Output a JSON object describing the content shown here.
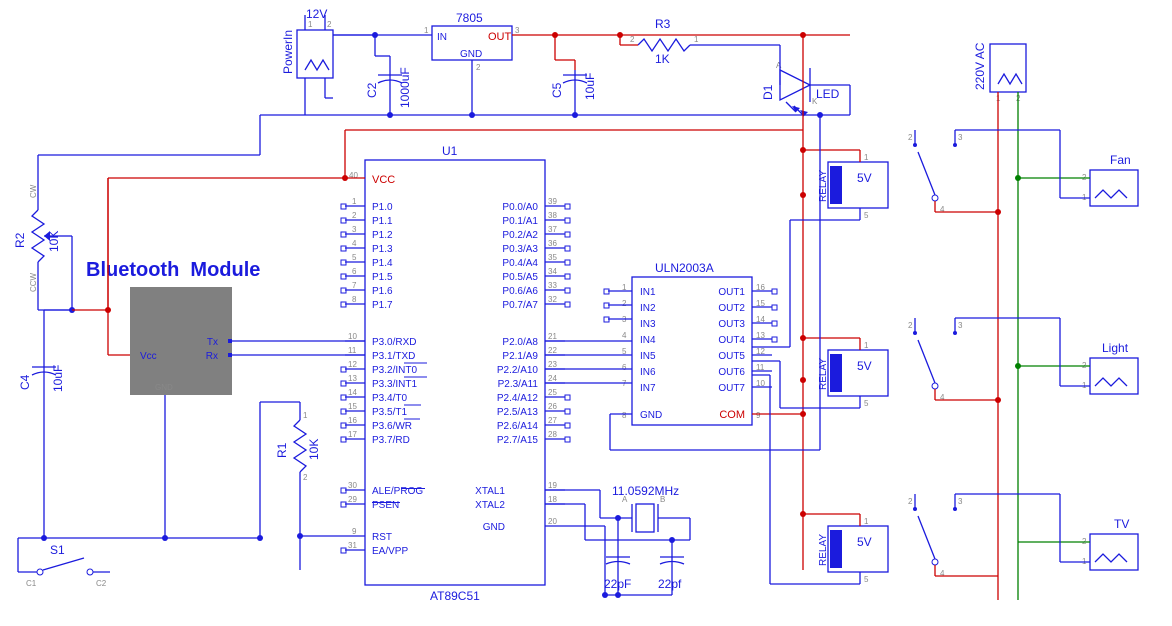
{
  "powerin": {
    "label": "PowerIn",
    "voltage": "12V"
  },
  "reg7805": {
    "label": "7805",
    "pins": {
      "in": "IN",
      "out": "OUT",
      "gnd": "GND"
    }
  },
  "c2": {
    "name": "C2",
    "val": "1000uF"
  },
  "c5": {
    "name": "C5",
    "val": "10uF"
  },
  "c4": {
    "name": "C4",
    "val": "10uF"
  },
  "r1": {
    "name": "R1",
    "val": "10K"
  },
  "r2": {
    "name": "R2",
    "val": "10K",
    "cw": "CW",
    "ccw": "CCW"
  },
  "r3": {
    "name": "R3",
    "val": "1K"
  },
  "d1": {
    "name": "D1",
    "val": "LED"
  },
  "s1": {
    "name": "S1",
    "c1": "C1",
    "c2": "C2"
  },
  "crystal": {
    "freq": "11.0592MHz",
    "a": "A",
    "b": "B"
  },
  "ccry1": "22pF",
  "ccry2": "22pf",
  "bt": {
    "title": "Bluetooth  Module",
    "vcc": "Vcc",
    "tx": "Tx",
    "rx": "Rx",
    "gnd": "GND"
  },
  "u1": {
    "ref": "U1",
    "part": "AT89C51",
    "vcc": "VCC",
    "p1": [
      "P1.0",
      "P1.1",
      "P1.2",
      "P1.3",
      "P1.4",
      "P1.5",
      "P1.6",
      "P1.7"
    ],
    "p1n": [
      "1",
      "2",
      "3",
      "4",
      "5",
      "6",
      "7",
      "8"
    ],
    "p0": [
      "P0.0/A0",
      "P0.1/A1",
      "P0.2/A2",
      "P0.3/A3",
      "P0.4/A4",
      "P0.5/A5",
      "P0.6/A6",
      "P0.7/A7"
    ],
    "p0n": [
      "39",
      "38",
      "37",
      "36",
      "35",
      "34",
      "33",
      "32"
    ],
    "p3": [
      "P3.0/RXD",
      "P3.1/TXD",
      "P3.2/INT0",
      "P3.3/INT1",
      "P3.4/T0",
      "P3.5/T1",
      "P3.6/WR",
      "P3.7/RD"
    ],
    "p3n": [
      "10",
      "11",
      "12",
      "13",
      "14",
      "15",
      "16",
      "17"
    ],
    "p2": [
      "P2.0/A8",
      "P2.1/A9",
      "P2.2/A10",
      "P2.3/A11",
      "P2.4/A12",
      "P2.5/A13",
      "P2.6/A14",
      "P2.7/A15"
    ],
    "p2n": [
      "21",
      "22",
      "23",
      "24",
      "25",
      "26",
      "27",
      "28"
    ],
    "ale": "ALE/PROG",
    "psen": "PSEN",
    "alen": "30",
    "psenn": "29",
    "rst": "RST",
    "ea": "EA/VPP",
    "rstn": "9",
    "ean": "31",
    "x1": "XTAL1",
    "x2": "XTAL2",
    "x1n": "19",
    "x2n": "18",
    "gnd": "GND",
    "gndn": "20",
    "vccn": "40"
  },
  "uln": {
    "part": "ULN2003A",
    "in": [
      "IN1",
      "IN2",
      "IN3",
      "IN4",
      "IN5",
      "IN6",
      "IN7"
    ],
    "inn": [
      "1",
      "2",
      "3",
      "4",
      "5",
      "6",
      "7"
    ],
    "out": [
      "OUT1",
      "OUT2",
      "OUT3",
      "OUT4",
      "OUT5",
      "OUT6",
      "OUT7"
    ],
    "outn": [
      "16",
      "15",
      "14",
      "13",
      "12",
      "11",
      "10"
    ],
    "gnd": "GND",
    "gndn": "8",
    "com": "COM",
    "comn": "9"
  },
  "relay": {
    "label": "RELAY",
    "coil": "5V",
    "p1": "1",
    "p2": "2",
    "p3": "3",
    "p4": "4",
    "p5": "5"
  },
  "ac": {
    "label": "220V AC"
  },
  "loads": {
    "fan": "Fan",
    "light": "Light",
    "tv": "TV"
  }
}
